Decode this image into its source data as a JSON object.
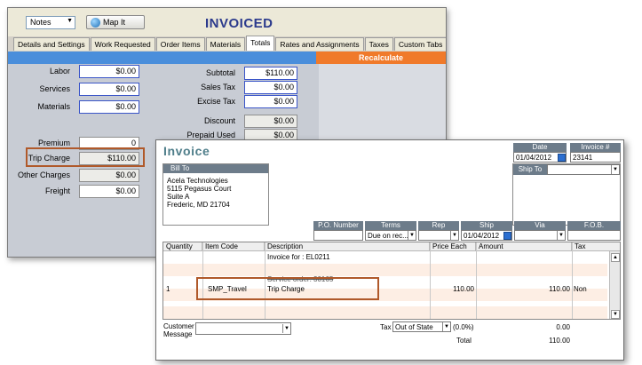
{
  "back_window": {
    "notes_dropdown": "Notes",
    "map_button": "Map It",
    "status_title": "INVOICED",
    "tabs": [
      "Details and Settings",
      "Work Requested",
      "Order Items",
      "Materials",
      "Totals",
      "Rates and Assignments",
      "Taxes",
      "Custom Tabs"
    ],
    "recalculate_button": "Recalculate",
    "left_fields": [
      {
        "label": "Labor",
        "value": "$0.00"
      },
      {
        "label": "Services",
        "value": "$0.00"
      },
      {
        "label": "Materials",
        "value": "$0.00"
      },
      {
        "label": "Premium",
        "value": "0"
      },
      {
        "label": "Trip Charge",
        "value": "$110.00"
      },
      {
        "label": "Other Charges",
        "value": "$0.00"
      },
      {
        "label": "Freight",
        "value": "$0.00"
      }
    ],
    "right_fields": [
      {
        "label": "Subtotal",
        "value": "$110.00"
      },
      {
        "label": "Sales Tax",
        "value": "$0.00"
      },
      {
        "label": "Excise Tax",
        "value": "$0.00"
      },
      {
        "label": "Discount",
        "value": "$0.00"
      },
      {
        "label": "Prepaid Used",
        "value": "$0.00"
      }
    ]
  },
  "invoice": {
    "title": "Invoice",
    "date_label": "Date",
    "date_value": "01/04/2012",
    "invoice_no_label": "Invoice #",
    "invoice_no_value": "23141",
    "bill_to_label": "Bill To",
    "bill_to_lines": [
      "Acela Technologies",
      "5115 Pegasus Court",
      "Suite A",
      "Frederic, MD 21704"
    ],
    "ship_to_label": "Ship To",
    "po_label": "P.O. Number",
    "terms_label": "Terms",
    "terms_value": "Due on rec...",
    "rep_label": "Rep",
    "ship_label": "Ship",
    "ship_value": "01/04/2012",
    "via_label": "Via",
    "fob_label": "F.O.B.",
    "columns": [
      "Quantity",
      "Item Code",
      "Description",
      "Price Each",
      "Amount",
      "Tax"
    ],
    "desc_line1": "Invoice for : EL0211",
    "desc_line2": "Service order: 30165",
    "row": {
      "quantity": "1",
      "item_code": "SMP_Travel",
      "description": "Trip Charge",
      "price": "110.00",
      "amount": "110.00",
      "tax": "Non"
    },
    "customer_message_label_1": "Customer",
    "customer_message_label_2": "Message",
    "tax_label": "Tax",
    "tax_value": "Out of State",
    "tax_rate": "(0.0%)",
    "tax_amount": "0.00",
    "total_label": "Total",
    "total_value": "110.00"
  },
  "colors": {
    "highlight": "#b0592a",
    "blue_band": "#4a8edb",
    "recalc": "#f07a2a",
    "invoice_title": "#4f7e8a"
  },
  "icons": [
    "globe-icon",
    "calendar-icon",
    "chevron-down-icon",
    "scroll-up-icon",
    "scroll-down-icon"
  ]
}
